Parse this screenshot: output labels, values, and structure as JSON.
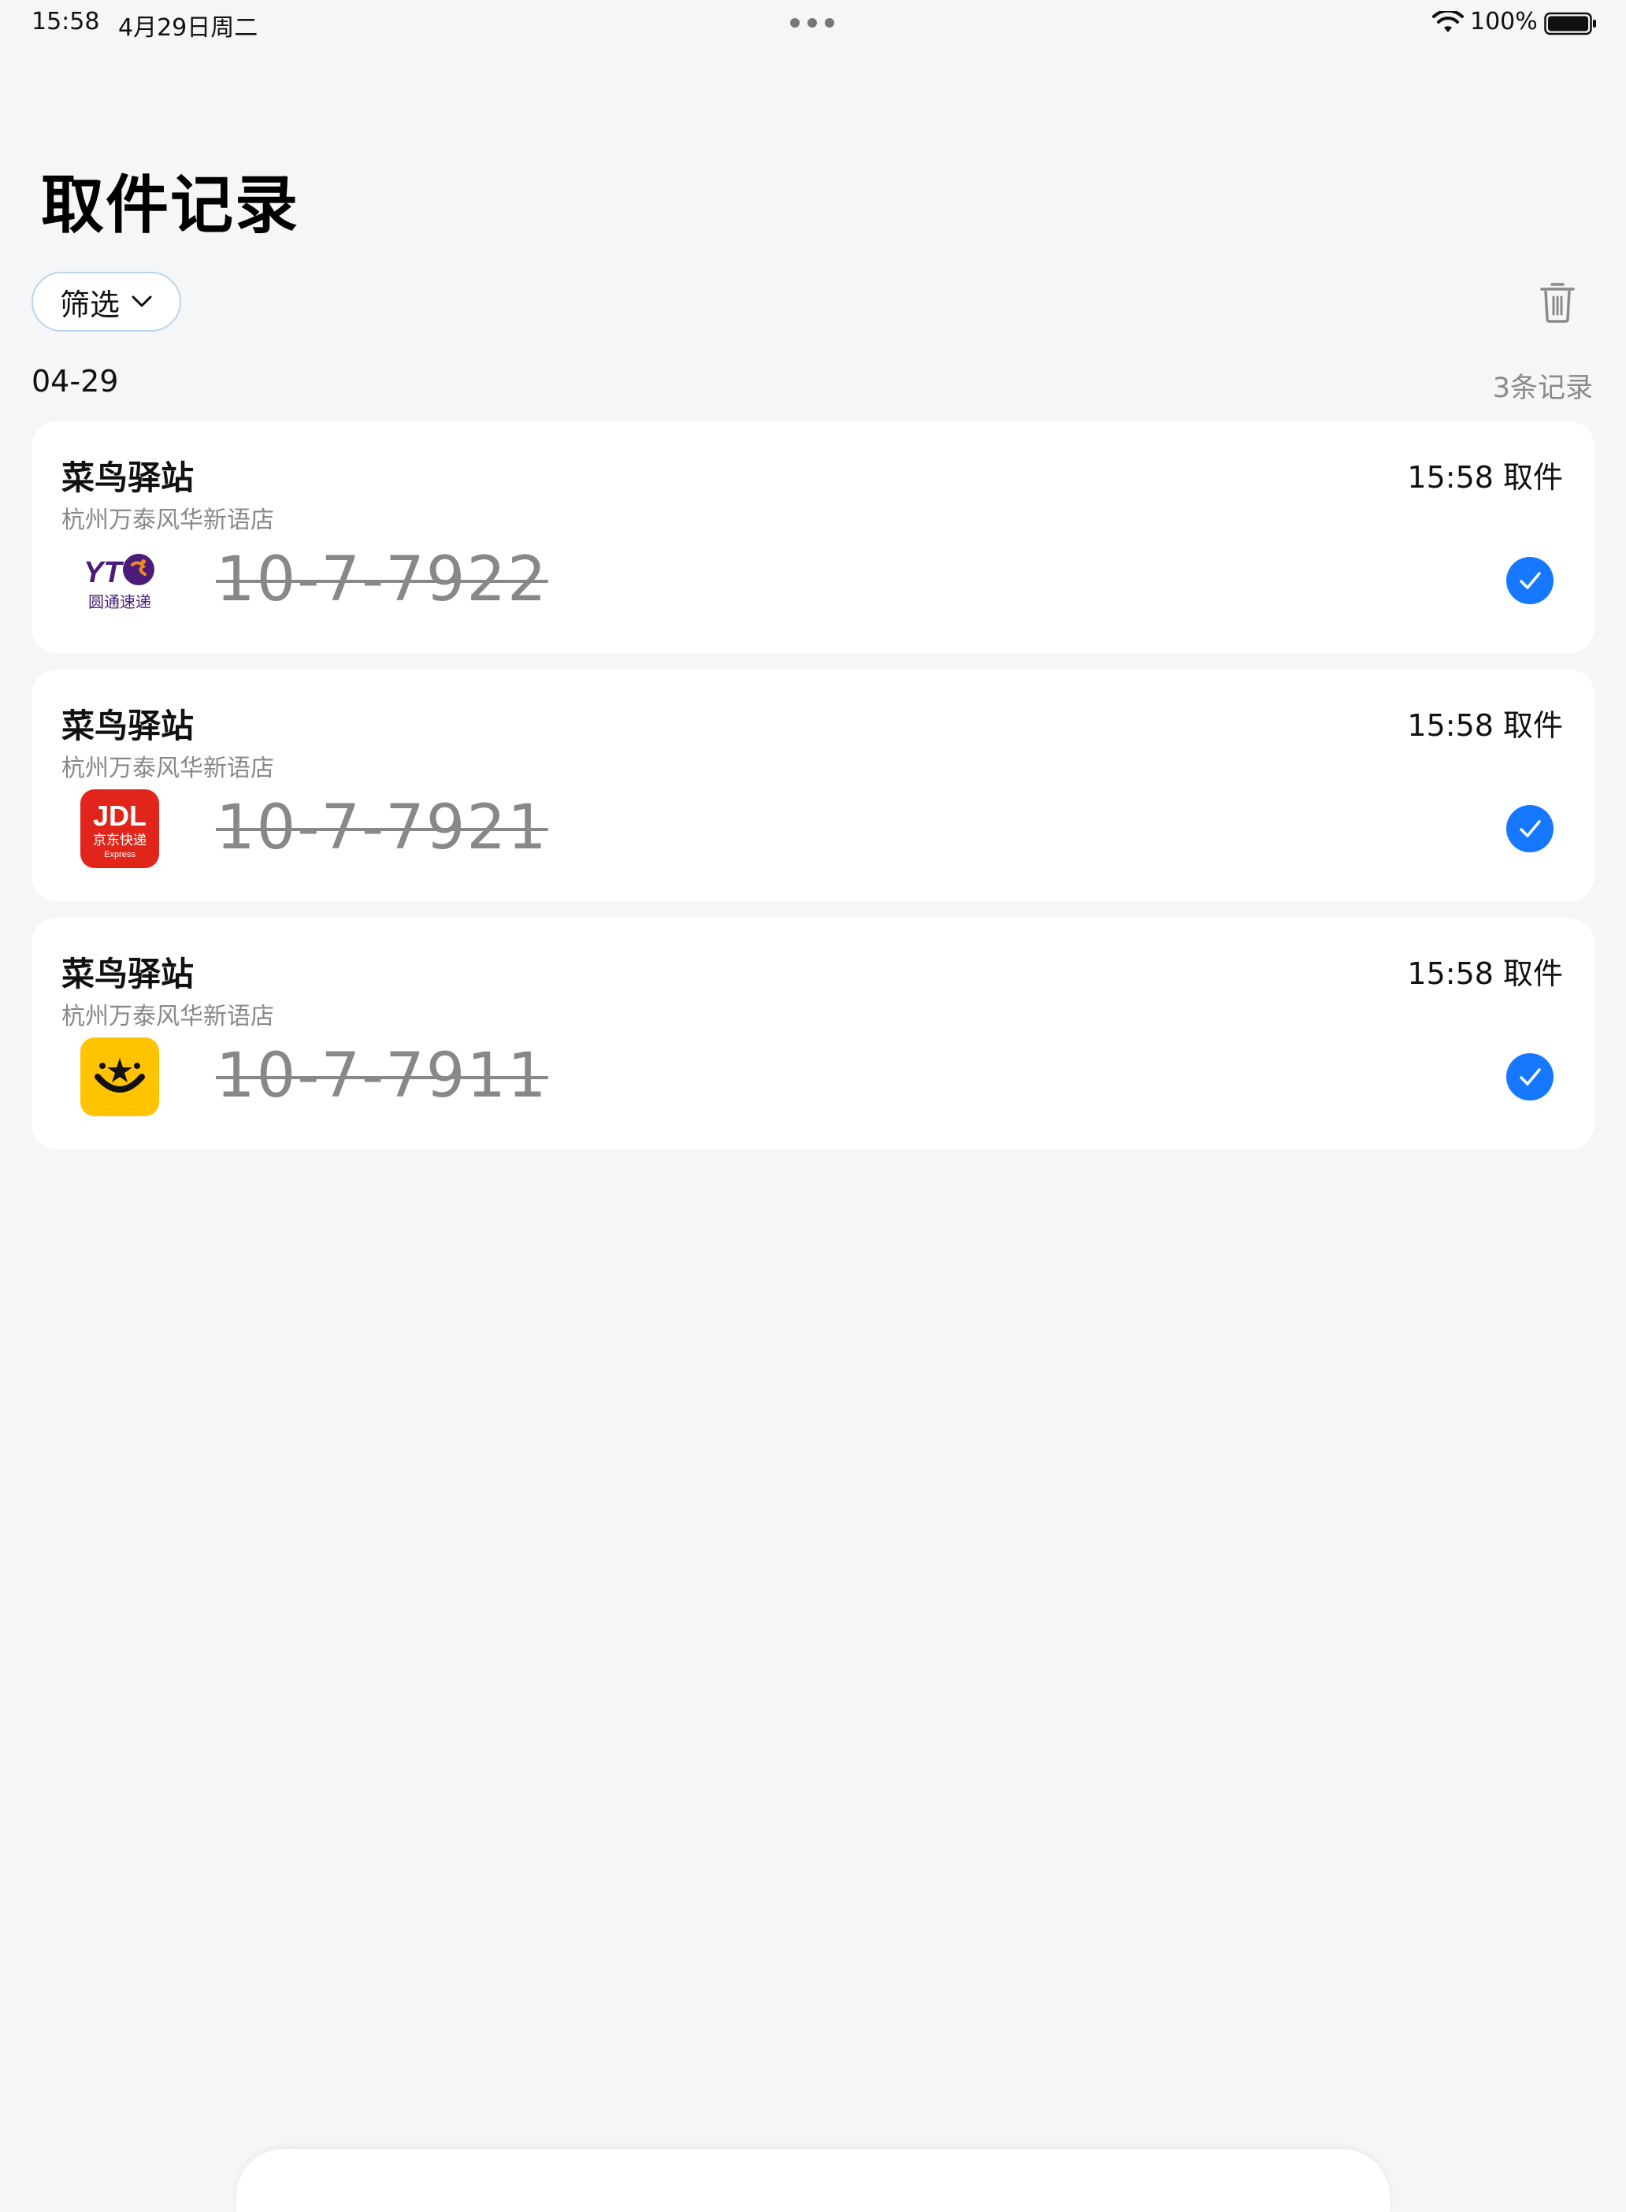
{
  "status_bar": {
    "time": "15:58",
    "date": "4月29日周二",
    "battery_percent": "100%",
    "battery_level": 1.0
  },
  "page": {
    "title": "取件记录"
  },
  "toolbar": {
    "filter_label": "筛选",
    "filter_icon": "chevron-down-icon",
    "delete_icon": "trash-icon"
  },
  "group": {
    "date": "04-29",
    "count": "3条记录"
  },
  "records": [
    {
      "station": "菜鸟驿站",
      "store": "杭州万泰风华新语店",
      "time": "15:58 取件",
      "code": "10-7-7922",
      "carrier_icon": "yto-express-logo",
      "carrier_logo_text": [
        "YT",
        "圆通速递"
      ],
      "checked": true
    },
    {
      "station": "菜鸟驿站",
      "store": "杭州万泰风华新语店",
      "time": "15:58 取件",
      "code": "10-7-7921",
      "carrier_icon": "jd-logistics-logo",
      "carrier_logo_text": [
        "JDL",
        "京东快递",
        "Express"
      ],
      "checked": true
    },
    {
      "station": "菜鸟驿站",
      "store": "杭州万泰风华新语店",
      "time": "15:58 取件",
      "code": "10-7-7911",
      "carrier_icon": "meituan-style-yellow-logo",
      "checked": true
    }
  ],
  "colors": {
    "background": "#f5f6f8",
    "accent": "#1677ff",
    "card": "#ffffff",
    "muted_text": "#888888"
  }
}
